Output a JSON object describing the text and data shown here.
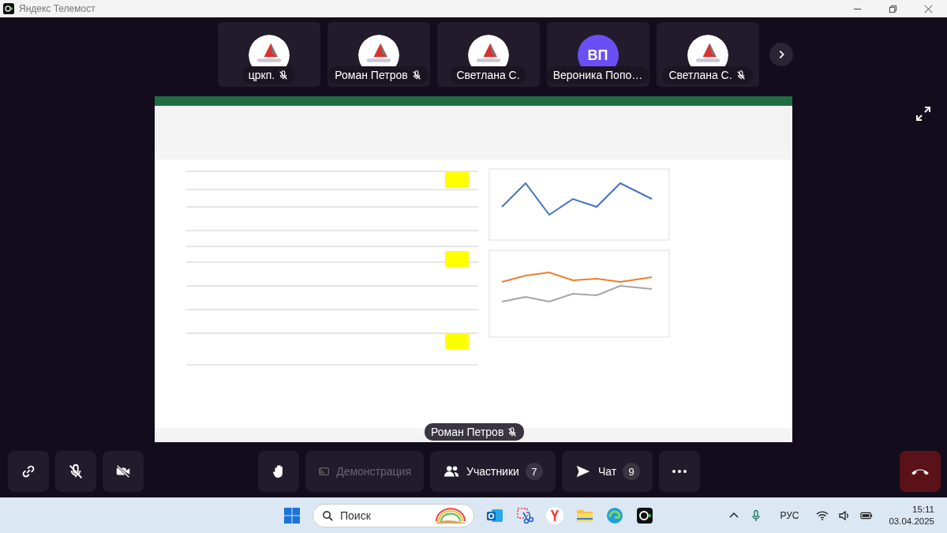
{
  "window": {
    "title": "Яндекс Телемост"
  },
  "participants": [
    {
      "name": "цркп.",
      "kind": "picture",
      "muted": true
    },
    {
      "name": "Роман Петров",
      "kind": "picture",
      "muted": true
    },
    {
      "name": "Светлана С.",
      "kind": "picture",
      "muted": false
    },
    {
      "name": "Вероника Попо…",
      "kind": "initials",
      "initials": "ВП",
      "muted": false
    },
    {
      "name": "Светлана С.",
      "kind": "picture",
      "muted": true
    }
  ],
  "screen_share": {
    "kind": "picture",
    "presenter": "Роман Петров",
    "presenter_muted": true
  },
  "toolbar": {
    "demo_label": "Демонстрация",
    "participants_label": "Участники",
    "participants_count": "7",
    "chat_label": "Чат",
    "chat_count": "9"
  },
  "taskbar": {
    "search_placeholder": "Поиск",
    "language": "РУС",
    "time": "15:11",
    "date": "03.04.2025"
  }
}
